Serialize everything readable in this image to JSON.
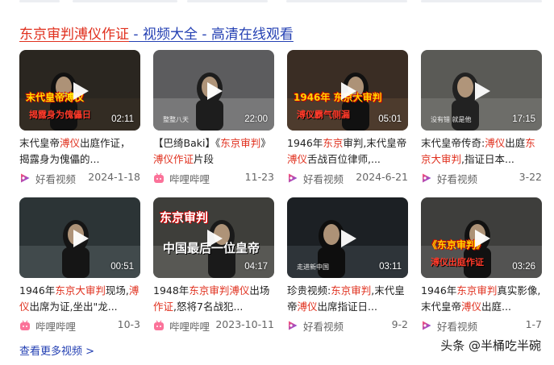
{
  "header": {
    "title_keyword": "东京审判溥仪作证",
    "title_rest": " - 视频大全 - 高清在线观看"
  },
  "videos": [
    {
      "duration": "02:11",
      "overlay_text": "末代皇帝溥仪",
      "overlay_text2": "揭露身为傀儡日",
      "thumb_caption": "",
      "desc_segments": [
        {
          "t": "末代皇帝",
          "h": false
        },
        {
          "t": "溥仪",
          "h": true
        },
        {
          "t": "出庭作证",
          "h": false
        },
        {
          "t": "，揭露身为傀儡的...",
          "h": false
        }
      ],
      "source": "好看视频",
      "source_icon": "haokan-icon",
      "date": "2024-1-18"
    },
    {
      "duration": "22:00",
      "overlay_text": "",
      "overlay_text2": "",
      "thumb_caption": "整整八天",
      "desc_segments": [
        {
          "t": "【巴绮Baki】《",
          "h": false
        },
        {
          "t": "东京审判",
          "h": true
        },
        {
          "t": "》 ",
          "h": false
        },
        {
          "t": "溥仪",
          "h": true
        },
        {
          "t": "作证",
          "h": true
        },
        {
          "t": "片段",
          "h": false
        }
      ],
      "source": "哔哩哔哩",
      "source_icon": "bilibili-icon",
      "date": "11-23"
    },
    {
      "duration": "05:01",
      "overlay_text": "1946年 东京大审判",
      "overlay_text2": "溥仪霸气侧漏",
      "thumb_caption": "",
      "desc_segments": [
        {
          "t": "1946年",
          "h": false
        },
        {
          "t": "东京",
          "h": true
        },
        {
          "t": "审判,末代皇帝",
          "h": false
        },
        {
          "t": "溥仪",
          "h": true
        },
        {
          "t": "舌战百位律师,...",
          "h": false
        }
      ],
      "source": "好看视频",
      "source_icon": "haokan-icon",
      "date": "2024-6-21"
    },
    {
      "duration": "17:15",
      "overlay_text": "",
      "overlay_text2": "",
      "thumb_caption": "没有错 就是他",
      "desc_segments": [
        {
          "t": "末代皇帝传奇:",
          "h": false
        },
        {
          "t": "溥仪",
          "h": true
        },
        {
          "t": "出庭",
          "h": false
        },
        {
          "t": "东京大审判",
          "h": true
        },
        {
          "t": ",指证日本...",
          "h": false
        }
      ],
      "source": "好看视频",
      "source_icon": "haokan-icon",
      "date": "3-22"
    },
    {
      "duration": "00:51",
      "overlay_text": "",
      "overlay_text2": "",
      "thumb_caption": "",
      "desc_segments": [
        {
          "t": "1946年",
          "h": false
        },
        {
          "t": "东京大审判",
          "h": true
        },
        {
          "t": "现场,",
          "h": false
        },
        {
          "t": "溥仪",
          "h": true
        },
        {
          "t": "出席为证,坐出\"龙...",
          "h": false
        }
      ],
      "source": "哔哩哔哩",
      "source_icon": "bilibili-icon",
      "date": "10-3"
    },
    {
      "duration": "04:17",
      "overlay_text": "东京审判",
      "overlay_text2": "中国最后一位皇帝",
      "thumb_caption": "",
      "desc_segments": [
        {
          "t": "1948年",
          "h": false
        },
        {
          "t": "东京审判溥仪",
          "h": true
        },
        {
          "t": "出",
          "h": false
        },
        {
          "t": "场",
          "h": false
        },
        {
          "t": "作证",
          "h": true
        },
        {
          "t": ",怒将7名战犯...",
          "h": false
        }
      ],
      "source": "哔哩哔哩",
      "source_icon": "bilibili-icon",
      "date": "2023-10-11"
    },
    {
      "duration": "03:11",
      "overlay_text": "",
      "overlay_text2": "",
      "thumb_caption": "走进新中国",
      "desc_segments": [
        {
          "t": "珍贵视频:",
          "h": false
        },
        {
          "t": "东京审判",
          "h": true
        },
        {
          "t": ",末代",
          "h": false
        },
        {
          "t": "皇帝",
          "h": false
        },
        {
          "t": "溥仪",
          "h": true
        },
        {
          "t": "出席指证日...",
          "h": false
        }
      ],
      "source": "好看视频",
      "source_icon": "haokan-icon",
      "date": "9-2"
    },
    {
      "duration": "03:26",
      "overlay_text": "《东京审判》",
      "overlay_text2": "溥仪出庭作证",
      "thumb_caption": "",
      "desc_segments": [
        {
          "t": "1946年",
          "h": false
        },
        {
          "t": "东京审判",
          "h": true
        },
        {
          "t": "真实影",
          "h": false
        },
        {
          "t": "像,末代皇帝",
          "h": false
        },
        {
          "t": "溥仪",
          "h": true
        },
        {
          "t": "出庭...",
          "h": false
        }
      ],
      "source": "好看视频",
      "source_icon": "haokan-icon",
      "date": "1-7"
    }
  ],
  "footer": {
    "more_link": "查看更多视频 >",
    "watermark": "头条 @半桶吃半碗"
  },
  "colors": {
    "highlight": "#e0301e",
    "link": "#2440b3",
    "haokan": "#6a4cf6",
    "bilibili": "#fb7299"
  }
}
